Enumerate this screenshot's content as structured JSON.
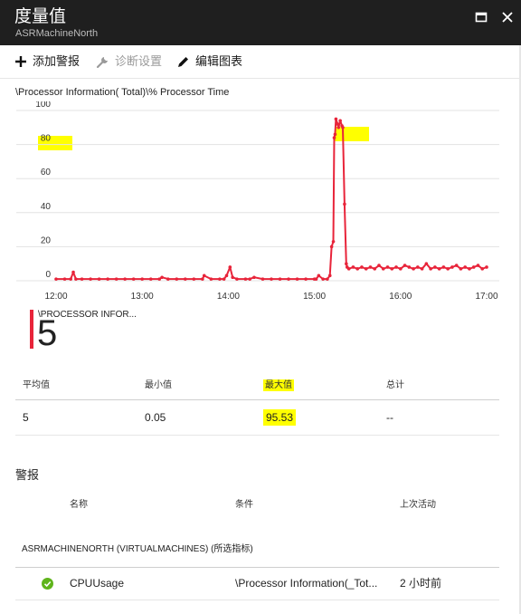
{
  "header": {
    "title": "度量值",
    "subtitle": "ASRMachineNorth"
  },
  "toolbar": {
    "add_alert": "添加警报",
    "diagnostics": "诊断设置",
    "edit_chart": "编辑图表"
  },
  "chart_data": {
    "type": "line",
    "title": "\\Processor Information( Total)\\% Processor Time",
    "x_ticks": [
      "12:00",
      "13:00",
      "14:00",
      "15:00",
      "16:00",
      "17:00"
    ],
    "y_ticks": [
      "0",
      "20",
      "40",
      "60",
      "80",
      "100"
    ],
    "ylim": [
      0,
      100
    ],
    "xlim": [
      11.92,
      17.0
    ],
    "grid": true,
    "series": [
      {
        "name": "\\PROCESSOR INFOR...",
        "color": "#e8243a",
        "x": [
          12.0,
          12.1,
          12.17,
          12.2,
          12.23,
          12.3,
          12.4,
          12.5,
          12.6,
          12.7,
          12.8,
          12.9,
          13.0,
          13.1,
          13.2,
          13.23,
          13.3,
          13.4,
          13.5,
          13.6,
          13.7,
          13.72,
          13.8,
          13.9,
          13.95,
          13.98,
          14.02,
          14.05,
          14.1,
          14.2,
          14.25,
          14.3,
          14.4,
          14.5,
          14.6,
          14.7,
          14.8,
          14.9,
          15.0,
          15.02,
          15.05,
          15.1,
          15.15,
          15.18,
          15.2,
          15.22,
          15.23,
          15.24,
          15.25,
          15.27,
          15.28,
          15.3,
          15.32,
          15.33,
          15.35,
          15.37,
          15.38,
          15.4,
          15.45,
          15.5,
          15.55,
          15.6,
          15.65,
          15.7,
          15.75,
          15.8,
          15.85,
          15.9,
          15.95,
          16.0,
          16.05,
          16.1,
          16.15,
          16.2,
          16.25,
          16.3,
          16.35,
          16.4,
          16.45,
          16.5,
          16.55,
          16.6,
          16.65,
          16.7,
          16.75,
          16.8,
          16.85,
          16.9,
          16.95,
          17.0
        ],
        "y": [
          1,
          1,
          1,
          5,
          1,
          1,
          1,
          1,
          1,
          1,
          1,
          1,
          1,
          1,
          1,
          2,
          1,
          1,
          1,
          1,
          1,
          3,
          1,
          1,
          1,
          3,
          8,
          2,
          1,
          1,
          1,
          2,
          1,
          1,
          1,
          1,
          1,
          1,
          1,
          1,
          3,
          1,
          1,
          3,
          20,
          23,
          84,
          86,
          95,
          92,
          90,
          94,
          91,
          90,
          45,
          10,
          8,
          7,
          8,
          7,
          8,
          7,
          8,
          7,
          9,
          7,
          8,
          7,
          8,
          7,
          9,
          8,
          7,
          8,
          7,
          10,
          7,
          8,
          7,
          8,
          7,
          8,
          9,
          7,
          8,
          7,
          8,
          9,
          7,
          8
        ]
      }
    ]
  },
  "legend": {
    "label": "\\PROCESSOR INFOR...",
    "value": "5"
  },
  "stats": {
    "headers": [
      "平均值",
      "最小值",
      "最大值",
      "总计"
    ],
    "values": [
      "5",
      "0.05",
      "95.53",
      "--"
    ]
  },
  "alerts": {
    "title": "警报",
    "columns": [
      "名称",
      "条件",
      "上次活动"
    ],
    "group": "ASRMACHINENORTH (VIRTUALMACHINES) (所选指标)",
    "rows": [
      {
        "name": "CPUUsage",
        "condition": "\\Processor Information(_Tot...",
        "last_activity": "2 小时前",
        "status": "ok"
      }
    ]
  },
  "colors": {
    "header_bg": "#1f1f1f",
    "series": "#e8243a",
    "highlight": "#ffff00",
    "ok": "#5fb41b"
  }
}
